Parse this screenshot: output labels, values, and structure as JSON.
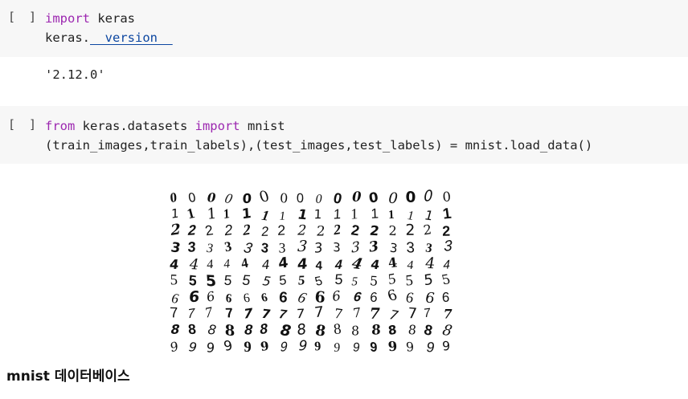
{
  "cells": [
    {
      "run_label": "[ ]",
      "lines": [
        [
          {
            "t": "import",
            "c": "kw"
          },
          {
            "t": " keras",
            "c": ""
          }
        ],
        [
          {
            "t": "keras.",
            "c": ""
          },
          {
            "t": "__version__",
            "c": "dunder"
          }
        ]
      ],
      "output": "'2.12.0'"
    },
    {
      "run_label": "[ ]",
      "lines": [
        [
          {
            "t": "from",
            "c": "kw"
          },
          {
            "t": " keras.datasets ",
            "c": ""
          },
          {
            "t": "import",
            "c": "kw"
          },
          {
            "t": " mnist",
            "c": ""
          }
        ],
        [
          {
            "t": "(train_images,train_labels),(test_images,test_labels) = mnist.load_data()",
            "c": ""
          }
        ]
      ]
    }
  ],
  "mnist_digits": [
    "0",
    "1",
    "2",
    "3",
    "4",
    "5",
    "6",
    "7",
    "8",
    "9"
  ],
  "caption": "mnist 데이터베이스"
}
